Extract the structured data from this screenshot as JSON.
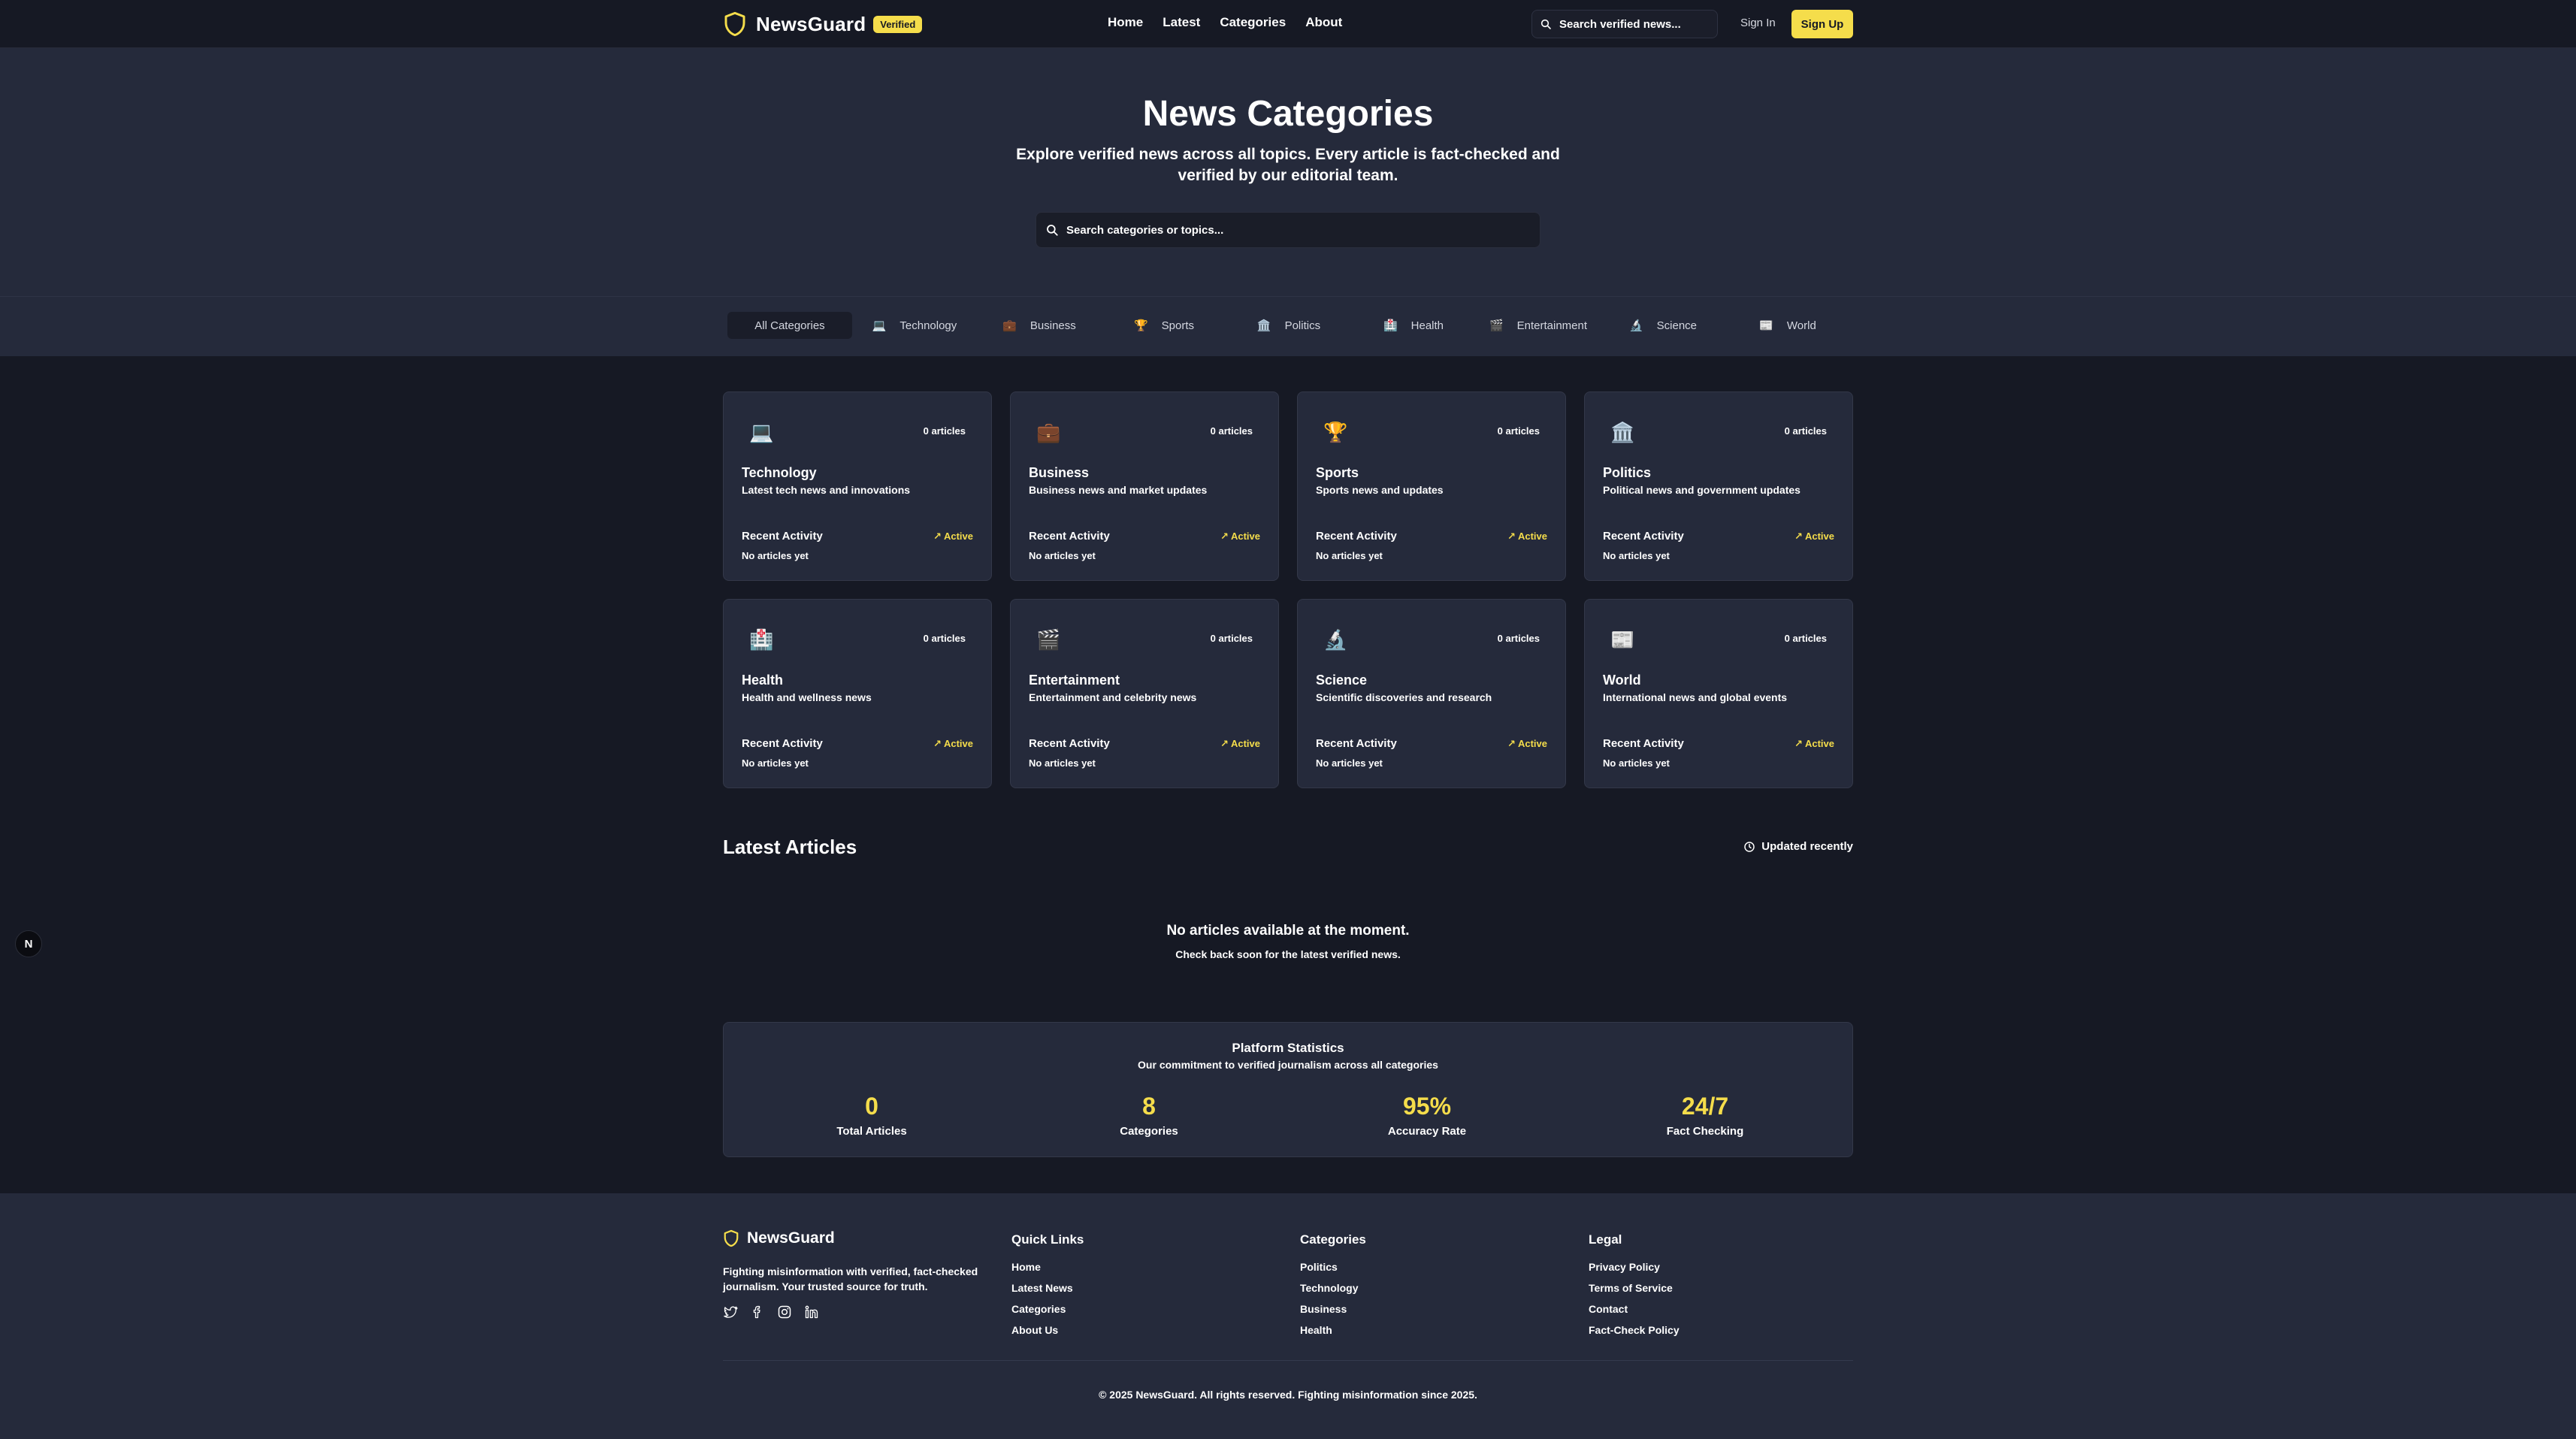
{
  "colors": {
    "accent": "#f5dd4b",
    "background": "#161924",
    "panel": "#252a3b"
  },
  "nav": {
    "brand": "NewsGuard",
    "badge": "Verified",
    "links": [
      "Home",
      "Latest",
      "Categories",
      "About"
    ],
    "search_placeholder": "Search verified news...",
    "sign_in": "Sign In",
    "sign_up": "Sign Up"
  },
  "hero": {
    "title": "News Categories",
    "subtitle": "Explore verified news across all topics. Every article is fact-checked and verified by our editorial team.",
    "search_placeholder": "Search categories or topics..."
  },
  "tabs": [
    {
      "label": "All Categories",
      "icon": ""
    },
    {
      "label": "Technology",
      "icon": "💻"
    },
    {
      "label": "Business",
      "icon": "💼"
    },
    {
      "label": "Sports",
      "icon": "🏆"
    },
    {
      "label": "Politics",
      "icon": "🏛️"
    },
    {
      "label": "Health",
      "icon": "🏥"
    },
    {
      "label": "Entertainment",
      "icon": "🎬"
    },
    {
      "label": "Science",
      "icon": "🔬"
    },
    {
      "label": "World",
      "icon": "📰"
    }
  ],
  "cards": [
    {
      "icon": "💻",
      "count": "0 articles",
      "name": "Technology",
      "desc": "Latest tech news and innovations",
      "activity": "Recent Activity",
      "status": "↗ Active",
      "empty": "No articles yet"
    },
    {
      "icon": "💼",
      "count": "0 articles",
      "name": "Business",
      "desc": "Business news and market updates",
      "activity": "Recent Activity",
      "status": "↗ Active",
      "empty": "No articles yet"
    },
    {
      "icon": "🏆",
      "count": "0 articles",
      "name": "Sports",
      "desc": "Sports news and updates",
      "activity": "Recent Activity",
      "status": "↗ Active",
      "empty": "No articles yet"
    },
    {
      "icon": "🏛️",
      "count": "0 articles",
      "name": "Politics",
      "desc": "Political news and government updates",
      "activity": "Recent Activity",
      "status": "↗ Active",
      "empty": "No articles yet"
    },
    {
      "icon": "🏥",
      "count": "0 articles",
      "name": "Health",
      "desc": "Health and wellness news",
      "activity": "Recent Activity",
      "status": "↗ Active",
      "empty": "No articles yet"
    },
    {
      "icon": "🎬",
      "count": "0 articles",
      "name": "Entertainment",
      "desc": "Entertainment and celebrity news",
      "activity": "Recent Activity",
      "status": "↗ Active",
      "empty": "No articles yet"
    },
    {
      "icon": "🔬",
      "count": "0 articles",
      "name": "Science",
      "desc": "Scientific discoveries and research",
      "activity": "Recent Activity",
      "status": "↗ Active",
      "empty": "No articles yet"
    },
    {
      "icon": "📰",
      "count": "0 articles",
      "name": "World",
      "desc": "International news and global events",
      "activity": "Recent Activity",
      "status": "↗ Active",
      "empty": "No articles yet"
    }
  ],
  "latest": {
    "title": "Latest Articles",
    "updated": "Updated recently",
    "empty_title": "No articles available at the moment.",
    "empty_sub": "Check back soon for the latest verified news."
  },
  "floater": {
    "label": "N"
  },
  "stats": {
    "title": "Platform Statistics",
    "subtitle": "Our commitment to verified journalism across all categories",
    "items": [
      {
        "value": "0",
        "label": "Total Articles"
      },
      {
        "value": "8",
        "label": "Categories"
      },
      {
        "value": "95%",
        "label": "Accuracy Rate"
      },
      {
        "value": "24/7",
        "label": "Fact Checking"
      }
    ]
  },
  "footer": {
    "brand": "NewsGuard",
    "description": "Fighting misinformation with verified, fact-checked journalism. Your trusted source for truth.",
    "socials": [
      "twitter-icon",
      "facebook-icon",
      "instagram-icon",
      "linkedin-icon"
    ],
    "columns": [
      {
        "title": "Quick Links",
        "links": [
          "Home",
          "Latest News",
          "Categories",
          "About Us"
        ]
      },
      {
        "title": "Categories",
        "links": [
          "Politics",
          "Technology",
          "Business",
          "Health"
        ]
      },
      {
        "title": "Legal",
        "links": [
          "Privacy Policy",
          "Terms of Service",
          "Contact",
          "Fact-Check Policy"
        ]
      }
    ],
    "copyright": "© 2025 NewsGuard. All rights reserved. Fighting misinformation since 2025."
  }
}
